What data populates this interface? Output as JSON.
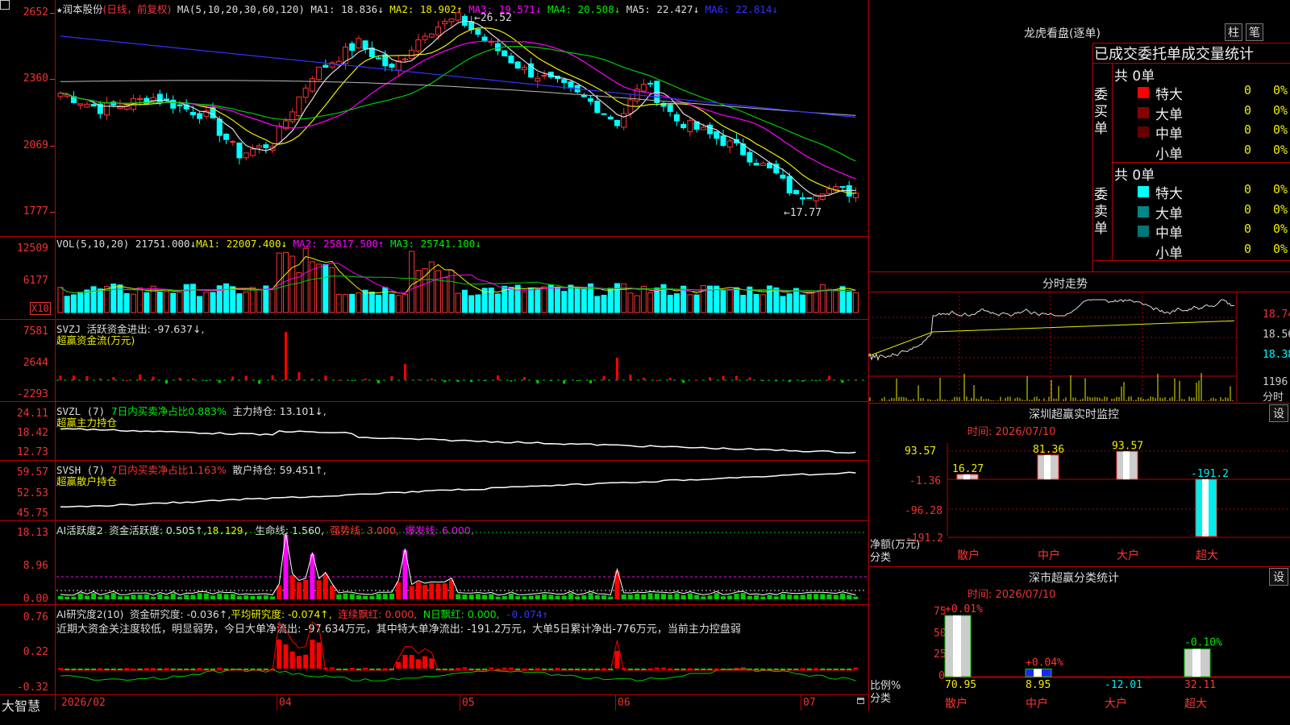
{
  "main": {
    "star": "★",
    "stock_name": "润本股份",
    "period": "(日线，前复权)",
    "ma_title": "MA(5,10,20,30,60,120)",
    "ma1": "MA1: 18.836↓",
    "ma2": "MA2: 18.902↑",
    "ma3": "MA3: 19.571↓",
    "ma4": "MA4: 20.508↓",
    "ma5": "MA5: 22.427↓",
    "ma6": "MA6: 22.814↓",
    "y_labels": [
      "2652",
      "2360",
      "2069",
      "1777"
    ],
    "high_mark": "26.52",
    "low_mark": "←17.77"
  },
  "vol": {
    "title": "VOL(5,10,20)",
    "val": "21751.000↓",
    "ma1": "MA1: 22007.400↓",
    "ma2": "MA2: 25817.500↑",
    "ma3": "MA3: 25741.100↓",
    "y_labels": [
      "12509",
      "6177"
    ],
    "unit": "X10"
  },
  "svzj": {
    "title": "SVZJ",
    "label": "活跃资金进出: -97.637↓,",
    "subtitle": "超赢资金流(万元)",
    "y_labels": [
      "7581",
      "2644",
      "-2293"
    ]
  },
  "svzl": {
    "title": "SVZL (7)",
    "ratio": "7日内买卖净占比0.883%",
    "hold": "主力持仓: 13.101↓,",
    "subtitle": "超赢主力持仓",
    "y_labels": [
      "24.11",
      "18.42",
      "12.73"
    ]
  },
  "svsh": {
    "title": "SVSH (7)",
    "ratio": "7日内买卖净占比1.163%",
    "hold": "散户持仓: 59.451↑,",
    "subtitle": "超赢散户持仓",
    "y_labels": [
      "59.57",
      "52.53",
      "45.75"
    ]
  },
  "ai1": {
    "title": "AI活跃度2",
    "act": "资金活跃度: 0.505↑,",
    "val2": "18.129,",
    "life": "生命线: 1.560,",
    "strong": "强势线: 3.000,",
    "burst": "爆发线: 6.000,",
    "y_labels": [
      "18.13",
      "8.96",
      "0.00"
    ]
  },
  "ai2": {
    "title": "AI研究度2(10)",
    "res": "资金研究度: -0.036↑,",
    "avg": "平均研究度: -0.074↑,",
    "cont": "连续飘红: 0.000,",
    "nday": "N日飘红: 0.000,",
    "last": "-0.074↑",
    "comment": "近期大资金关注度较低，明显弱势，今日大单净流出: -97.634万元，其中特大单净流出: -191.2万元，大单5日累计净出-776万元，当前主力控盘弱",
    "y_labels": [
      "0.76",
      "0.22",
      "-0.32"
    ]
  },
  "x_axis": {
    "brand": "大智慧",
    "labels": [
      "2026/02",
      "04",
      "05",
      "06",
      "07"
    ]
  },
  "right": {
    "lh_title": "龙虎看盘(逐单)",
    "btn_bar": "柱",
    "btn_stroke": "笔",
    "lh_header": "已成交委托单成交量统计",
    "buy_label": "委买单",
    "sell_label": "委卖单",
    "buy_total": "共 0单",
    "sell_total": "共 0单",
    "buy_rows": [
      {
        "name": "特大",
        "v1": "0",
        "v2": "0%",
        "color": "#ff0000"
      },
      {
        "name": "大单",
        "v1": "0",
        "v2": "0%",
        "color": "#880000"
      },
      {
        "name": "中单",
        "v1": "0",
        "v2": "0%",
        "color": "#660000"
      },
      {
        "name": "小单",
        "v1": "0",
        "v2": "0%",
        "color": "#000000"
      }
    ],
    "sell_rows": [
      {
        "name": "特大",
        "v1": "0",
        "v2": "0%",
        "color": "#00ffff"
      },
      {
        "name": "大单",
        "v1": "0",
        "v2": "0%",
        "color": "#008888"
      },
      {
        "name": "中单",
        "v1": "0",
        "v2": "0%",
        "color": "#007777"
      },
      {
        "name": "小单",
        "v1": "0",
        "v2": "0%",
        "color": "#000000"
      }
    ],
    "intraday_title": "分时走势",
    "intraday_y": [
      "18.74",
      "18.56",
      "18.38",
      "1196"
    ],
    "intraday_unit": "分时",
    "sz_title": "深圳超赢实时监控",
    "sz_time": "时间: 2026/07/10",
    "sz_y": [
      "93.57",
      "-1.36",
      "-96.28",
      "-191.2"
    ],
    "sz_unit": "净额(万元)",
    "sz_cat_label": "分类",
    "cat_labels": [
      "散户",
      "中户",
      "大户",
      "超大"
    ],
    "sz_chart": {
      "type": "bar",
      "categories": [
        "散户",
        "中户",
        "大户",
        "超大"
      ],
      "values": [
        16.27,
        81.36,
        93.57,
        -191.2
      ],
      "labels": [
        "16.27",
        "81.36",
        "93.57",
        "-191.2"
      ]
    },
    "btn_set": "设",
    "cls_title": "深市超赢分类统计",
    "cls_time": "时间: 2026/07/10",
    "cls_y": [
      "75",
      "50",
      "25",
      "0"
    ],
    "cls_unit": "比例%",
    "cls_cat_label": "分类",
    "cls_chart": {
      "type": "bar",
      "categories": [
        "散户",
        "中户",
        "大户",
        "超大"
      ],
      "values": [
        70.95,
        8.95,
        0,
        32.11
      ],
      "top_labels": [
        "+0.01%",
        "+0.04%",
        "",
        "-0.10%"
      ],
      "bottom_labels": [
        "70.95",
        "8.95",
        "-12.01",
        "32.11"
      ]
    }
  },
  "colors": {
    "up": "#ff3333",
    "down": "#00ffff",
    "grid": "#bb0000"
  }
}
